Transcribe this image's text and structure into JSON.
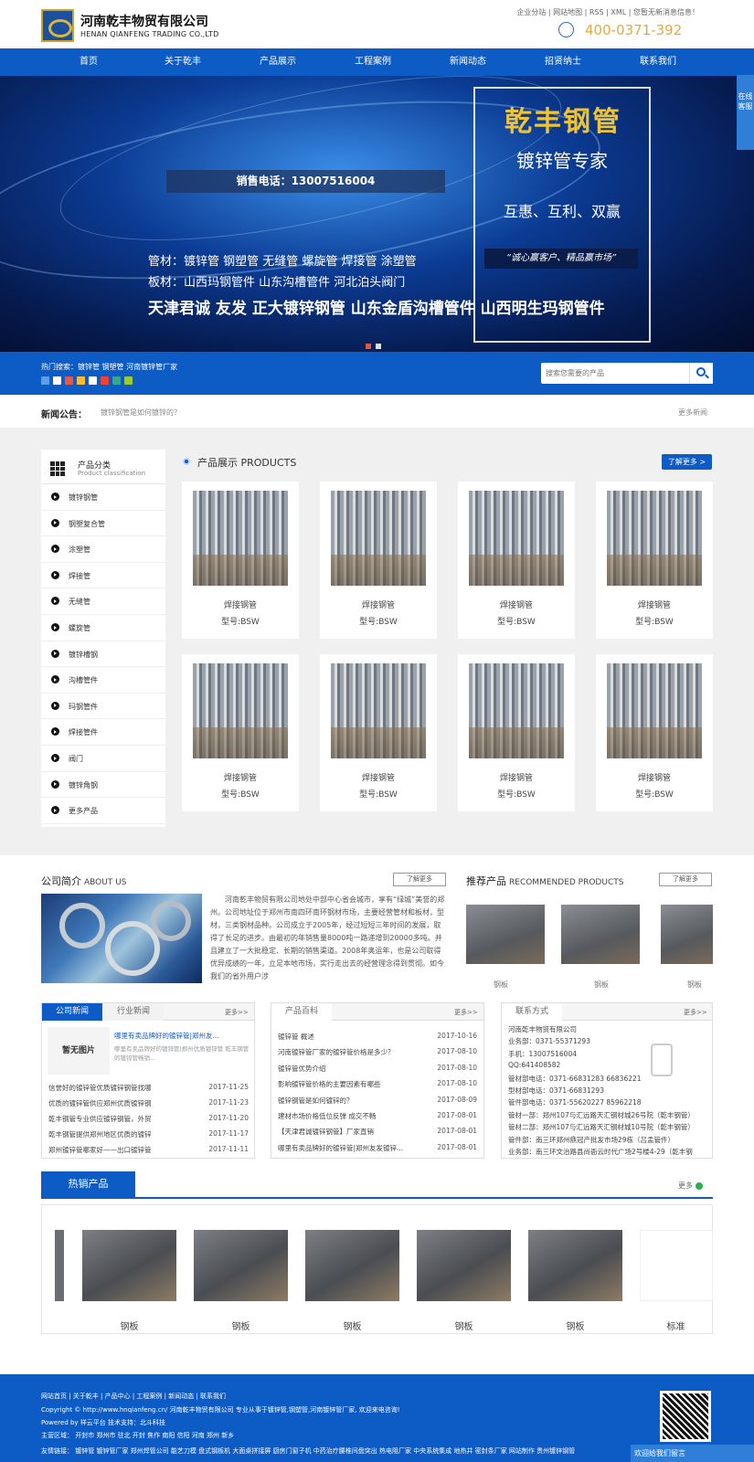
{
  "header": {
    "company_name": "河南乾丰物贸有限公司",
    "company_en": "HENAN QIANFENG TRADING CO.,LTD",
    "top_links": "企业分站 | 网站地图 | RSS | XML | 您暂无新消息信息！",
    "phone": "400-0371-392"
  },
  "nav": [
    "首页",
    "关于乾丰",
    "产品展示",
    "工程案例",
    "新闻动态",
    "招贤纳士",
    "联系我们"
  ],
  "banner": {
    "sale_phone": "销售电话：13007516004",
    "brand_title": "乾丰钢管",
    "brand_sub": "镀锌管专家",
    "brand_motto": "互惠、互利、双赢",
    "brand_quote": "“诚心赢客户、精品赢市场”",
    "line1": "管材：镀锌管 钢塑管 无缝管 螺旋管 焊接管 涂塑管",
    "line2": "板材：山西玛钢管件 山东沟槽管件 河北泊头阀门",
    "line3": "天津君诚 友发 正大镀锌钢管 山东金盾沟槽管件 山西明生玛钢管件",
    "active_slide": 2,
    "slides": 2
  },
  "online_tab": "在线客服",
  "search": {
    "hot": "热门搜索：镀锌管 钢塑管 河南镀锌管厂家",
    "placeholder": "搜索您需要的产品"
  },
  "notice": {
    "label": "新闻公告：",
    "text": "镀锌钢管是如何镀锌的？",
    "more": "更多新闻"
  },
  "sidebar": {
    "title": "产品分类",
    "subtitle": "Product classification",
    "items": [
      "镀锌钢管",
      "钢塑复合管",
      "涂塑管",
      "焊接管",
      "无缝管",
      "螺旋管",
      "镀锌槽钢",
      "沟槽管件",
      "玛钢管件",
      "焊接管件",
      "阀门",
      "镀锌角钢",
      "更多产品"
    ]
  },
  "products": {
    "title": "产品展示  PRODUCTS",
    "more": "了解更多 >",
    "items": [
      {
        "name": "焊接钢管",
        "model": "型号:BSW"
      },
      {
        "name": "焊接钢管",
        "model": "型号:BSW"
      },
      {
        "name": "焊接钢管",
        "model": "型号:BSW"
      },
      {
        "name": "焊接钢管",
        "model": "型号:BSW"
      },
      {
        "name": "焊接钢管",
        "model": "型号:BSW"
      },
      {
        "name": "焊接钢管",
        "model": "型号:BSW"
      },
      {
        "name": "焊接钢管",
        "model": "型号:BSW"
      },
      {
        "name": "焊接钢管",
        "model": "型号:BSW"
      }
    ]
  },
  "about": {
    "title": "公司简介",
    "title_en": "ABOUT US",
    "more": "了解更多",
    "text": "河南乾丰物贸有限公司地处中部中心省会城市，享有“绿城”美誉的郑州。公司地址位于郑州市南四环南环钢材市场，主要经营管材和板材，型材，三类钢材品种。公司成立于2005年，经过短短三年时间的发展，取得了长足的进步。由最初的年销售量8000吨一路递增到20000多吨。并且建立了一大批稳定、长期的销售渠道。2008年奥运年，也是公司取得优异成绩的一年，立足本地市场，实行走出去的经营理念得到贯彻。如今我们的省外用户涉"
  },
  "recommended": {
    "title": "推荐产品",
    "title_en": "RECOMMENDED PRODUCTS",
    "more": "了解更多",
    "items": [
      "钢板",
      "钢板",
      "钢板"
    ]
  },
  "news": {
    "tab_active": "公司新闻",
    "tab_inactive": "行业新闻",
    "more": "更多>>",
    "featured_img": "暂无图片",
    "featured_title": "哪里有卖品牌好的镀锌管|郑州友...",
    "featured_desc": "哪里有卖品牌好的镀锌管|郑州优质镀锌管 乾丰钢管的镀锌管畅销...",
    "rows": [
      {
        "t": "信誉好的镀锌管优质镀锌钢管找哪",
        "d": "2017-11-25"
      },
      {
        "t": "优质的镀锌管供应郑州优质镀锌钢",
        "d": "2017-11-23"
      },
      {
        "t": "乾丰钢管专业供应镀锌钢管，外贸",
        "d": "2017-11-20"
      },
      {
        "t": "乾丰钢管提供郑州地区优质的镀锌",
        "d": "2017-11-17"
      },
      {
        "t": "郑州镀锌管哪家好——出口镀锌管",
        "d": "2017-11-11"
      }
    ]
  },
  "encyclopedia": {
    "title": "产品百科",
    "more": "更多>>",
    "rows": [
      {
        "t": "镀锌管 概述",
        "d": "2017-10-16"
      },
      {
        "t": "河南镀锌管厂家的镀锌管价格是多少？",
        "d": "2017-08-10"
      },
      {
        "t": "镀锌管优势介绍",
        "d": "2017-08-10"
      },
      {
        "t": "影响镀锌管价格的主要因素有哪些",
        "d": "2017-08-10"
      },
      {
        "t": "镀锌钢管是如何镀锌的？",
        "d": "2017-08-09"
      },
      {
        "t": "建材市场价格低位反弹 成交不畅",
        "d": "2017-08-01"
      },
      {
        "t": "【天津君诚镀锌钢管】厂家直销",
        "d": "2017-08-01"
      },
      {
        "t": "哪里有卖品牌好的镀锌管|郑州友发镀锌...",
        "d": "2017-08-01"
      }
    ]
  },
  "contact": {
    "title": "联系方式",
    "more": "更多>>",
    "lines": [
      "河南乾丰物贸有限公司",
      "业务部：0371-55371293",
      "手机：13007516004",
      "QQ:641408582",
      "管材部电话：0371-66831283 66836221",
      "型材部电话：0371-66831293",
      "管件部电话：0371-55620227 85962218",
      "管材一部：郑州107与汇远路天汇钢材城26号院（乾丰钢管）",
      "管材二部：郑州107与汇远路天汇钢材城10号院（乾丰钢管）",
      "管件部：南三环郑州鼎冠产批发市场29栋（吕孟管件）",
      "业务部：南三环文治路县尚衙云时代广场2号楼4-29（乾丰钢"
    ]
  },
  "hot_products": {
    "title": "热销产品",
    "more": "更多",
    "items": [
      "钢板",
      "钢板",
      "钢板",
      "钢板",
      "钢板",
      "标准"
    ]
  },
  "footer": {
    "links": "网站首页 | 关于乾丰 | 产品中心 | 工程案例 | 新闻动态 | 联系我们",
    "copyright": "Copyright © http://www.hnqianfeng.cn/ 河南乾丰物贸有限公司 专业从事于镀锌管,钢塑管,河南镀锌管厂家, 欢迎来电咨询!",
    "powered": "Powered by 祥云平台   技术支持：北斗科技",
    "area": "主营区域：  开封市  郑州市  驻北  开封  焦作  南阳  信阳  河南  郑州  新乡",
    "friends": "友情链接：  镀锌管  镀锌管厂家  郑州焊管公司  能艺刀模  盘式钢板机  大面桌拼接屏  厨房门窗子机  中药治疗腰椎间盘突出  热电阻厂家  中央系统集成  地热井  密封条厂家  网站制作  贵州镀锌钢管",
    "message_bar": "欢迎给我们留言"
  }
}
